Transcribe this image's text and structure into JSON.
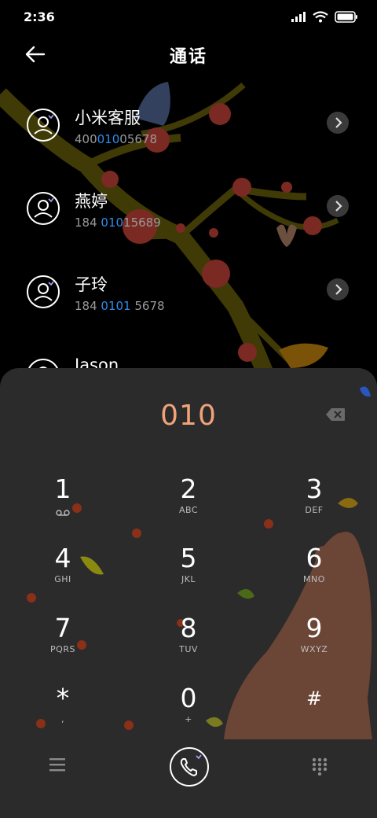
{
  "status_bar": {
    "time": "2:36"
  },
  "header": {
    "title": "通话"
  },
  "contacts": [
    {
      "name": "小米客服",
      "num_pre": "400",
      "num_hl": "010",
      "num_post": "05678"
    },
    {
      "name": "燕婷",
      "num_pre": "184 ",
      "num_hl": "010",
      "num_post": "15689"
    },
    {
      "name": "子玲",
      "num_pre": "184 ",
      "num_hl": "0101",
      "num_post": " 5678"
    },
    {
      "name": "Jason"
    }
  ],
  "dialer": {
    "typed_number": "010",
    "keys": [
      {
        "digit": "1",
        "letters": ""
      },
      {
        "digit": "2",
        "letters": "ABC"
      },
      {
        "digit": "3",
        "letters": "DEF"
      },
      {
        "digit": "4",
        "letters": "GHI"
      },
      {
        "digit": "5",
        "letters": "JKL"
      },
      {
        "digit": "6",
        "letters": "MNO"
      },
      {
        "digit": "7",
        "letters": "PQRS"
      },
      {
        "digit": "8",
        "letters": "TUV"
      },
      {
        "digit": "9",
        "letters": "WXYZ"
      },
      {
        "digit": "*",
        "letters": ","
      },
      {
        "digit": "0",
        "letters": "+"
      },
      {
        "digit": "#",
        "letters": ""
      }
    ]
  },
  "colors": {
    "accent_number": "#f0a37a",
    "match_highlight": "#2f8be8",
    "panel_bg": "#2b2b2b"
  }
}
